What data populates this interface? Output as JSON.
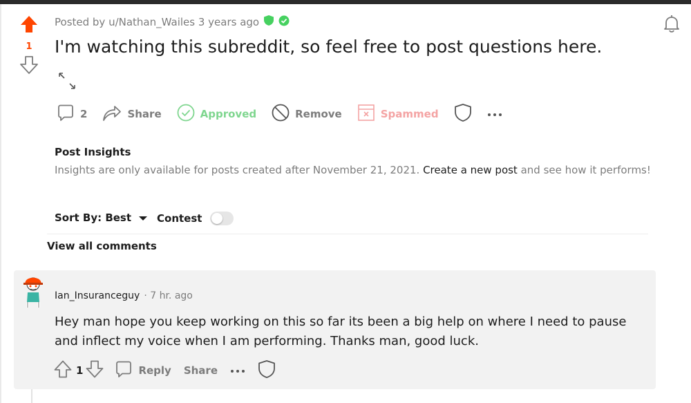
{
  "post": {
    "author_line": "Posted by u/Nathan_Wailes 3 years ago",
    "vote_count": "1",
    "title": "I'm watching this subreddit, so feel free to post questions here.",
    "comment_count": "2",
    "actions": {
      "share": "Share",
      "approved": "Approved",
      "remove": "Remove",
      "spammed": "Spammed"
    }
  },
  "insights": {
    "title": "Post Insights",
    "text_before": "Insights are only available for posts created after November 21, 2021. ",
    "link": "Create a new post",
    "text_after": " and see how it performs!"
  },
  "comments_bar": {
    "sort_label": "Sort By: Best",
    "contest_label": "Contest",
    "view_all": "View all comments"
  },
  "comment": {
    "author": "Ian_Insuranceguy",
    "time": "· 7 hr. ago",
    "body": "Hey man hope you keep working on this so far its been a big help on where I need to pause and inflect my voice when I am performing. Thanks man, good luck.",
    "vote_count": "1",
    "reply": "Reply",
    "share": "Share"
  },
  "colors": {
    "upvote": "#ff4500",
    "approved": "#7fd68f",
    "spammed": "#f4a3a3",
    "mod_shield": "#46d160"
  }
}
